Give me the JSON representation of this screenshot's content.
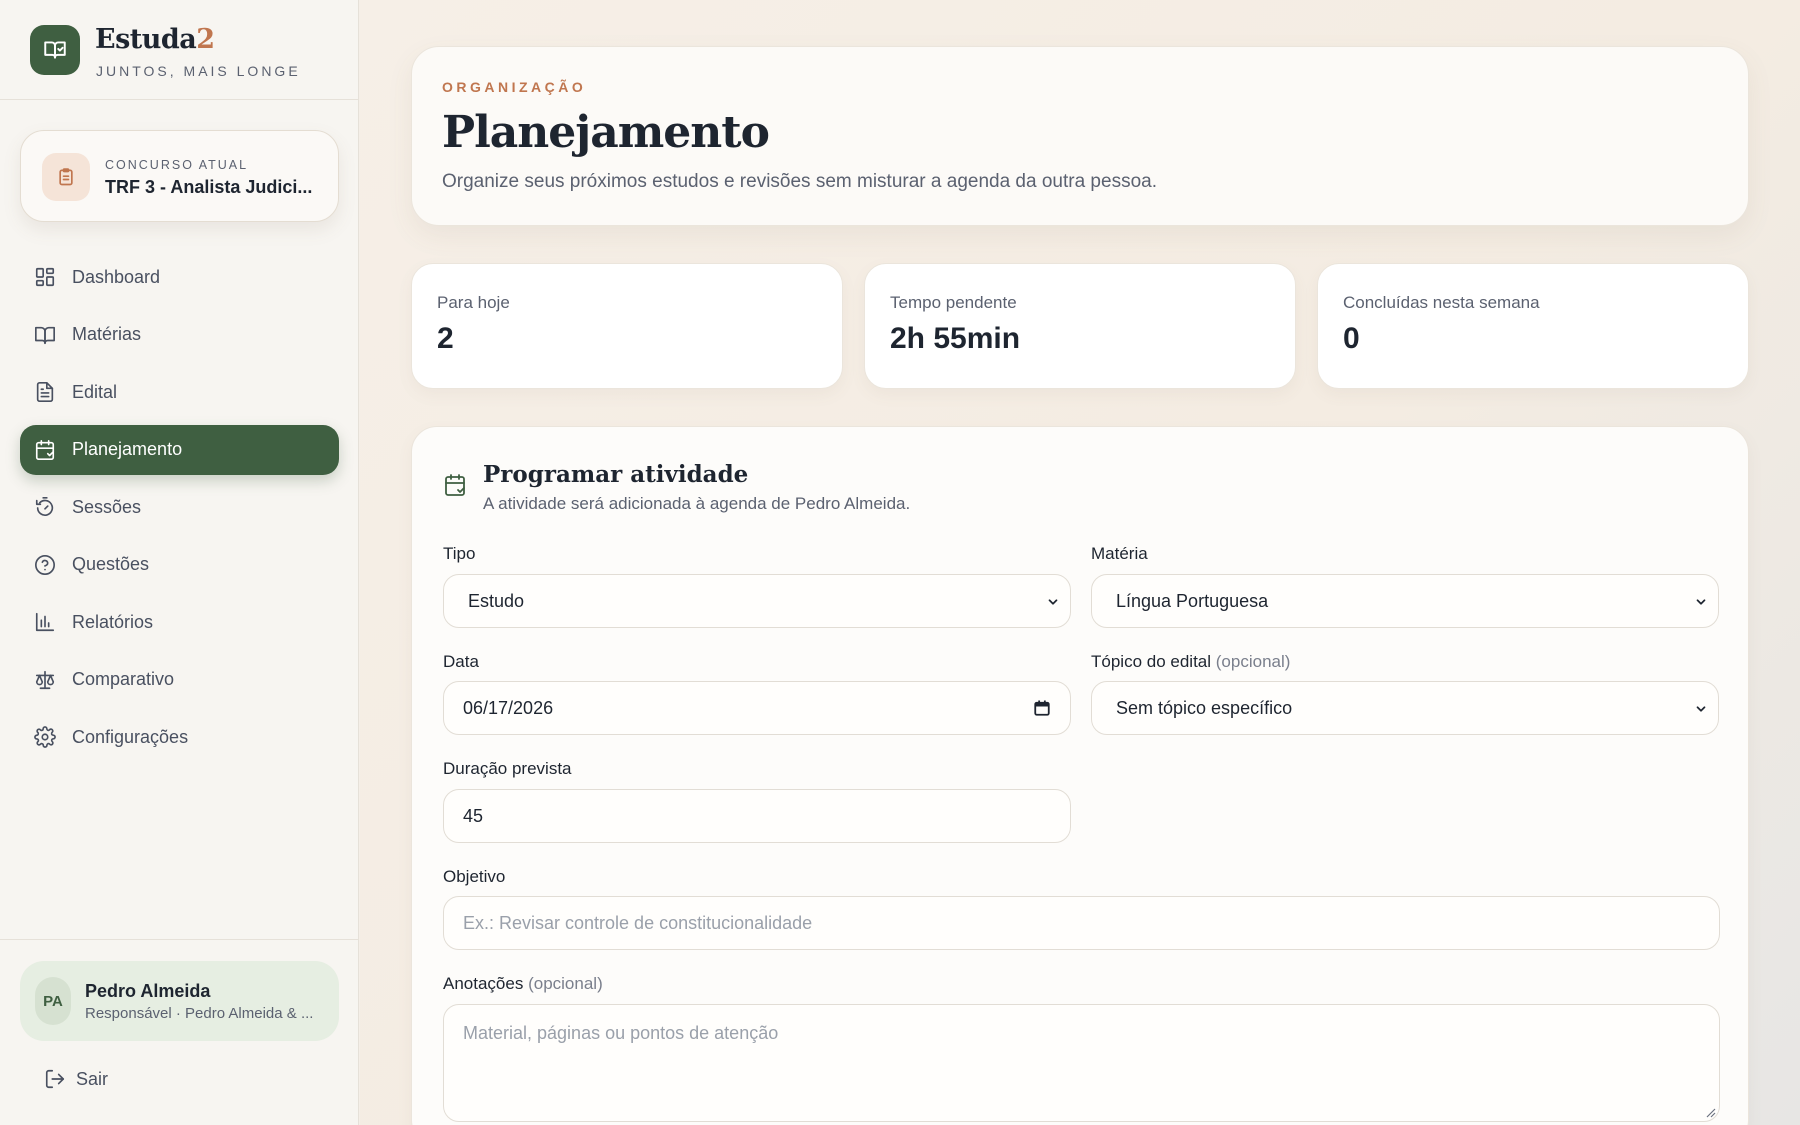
{
  "brand": {
    "name_main": "Estuda",
    "name_accent": "2",
    "tagline": "JUNTOS, MAIS LONGE"
  },
  "contest": {
    "label": "CONCURSO ATUAL",
    "name": "TRF 3 - Analista Judici..."
  },
  "nav": {
    "items": [
      {
        "label": "Dashboard",
        "icon": "grid-icon"
      },
      {
        "label": "Matérias",
        "icon": "book-icon"
      },
      {
        "label": "Edital",
        "icon": "document-icon"
      },
      {
        "label": "Planejamento",
        "icon": "calendar-check-icon",
        "active": true
      },
      {
        "label": "Sessões",
        "icon": "timer-icon"
      },
      {
        "label": "Questões",
        "icon": "help-circle-icon"
      },
      {
        "label": "Relatórios",
        "icon": "bar-chart-icon"
      },
      {
        "label": "Comparativo",
        "icon": "scale-icon"
      },
      {
        "label": "Configurações",
        "icon": "gear-icon"
      }
    ]
  },
  "user": {
    "initials": "PA",
    "name": "Pedro Almeida",
    "role": "Responsável · Pedro Almeida & ..."
  },
  "logout_label": "Sair",
  "header": {
    "eyebrow": "ORGANIZAÇÃO",
    "title": "Planejamento",
    "description": "Organize seus próximos estudos e revisões sem misturar a agenda da outra pessoa."
  },
  "stats": [
    {
      "label": "Para hoje",
      "value": "2"
    },
    {
      "label": "Tempo pendente",
      "value": "2h 55min"
    },
    {
      "label": "Concluídas nesta semana",
      "value": "0"
    }
  ],
  "form": {
    "title": "Programar atividade",
    "subtitle": "A atividade será adicionada à agenda de Pedro Almeida.",
    "tipo_label": "Tipo",
    "tipo_value": "Estudo",
    "materia_label": "Matéria",
    "materia_value": "Língua Portuguesa",
    "data_label": "Data",
    "data_value": "06/17/2026",
    "topico_label": "Tópico do edital",
    "topico_optional": "(opcional)",
    "topico_value": "Sem tópico específico",
    "duracao_label": "Duração prevista",
    "duracao_value": "45",
    "objetivo_label": "Objetivo",
    "objetivo_placeholder": "Ex.: Revisar controle de constitucionalidade",
    "anotacoes_label": "Anotações",
    "anotacoes_optional": "(opcional)",
    "anotacoes_placeholder": "Material, páginas ou pontos de atenção"
  },
  "colors": {
    "primary": "#3f5f41",
    "accent": "#c0764f",
    "sidebar_bg": "#f7f5f1",
    "text": "#1e2530"
  }
}
